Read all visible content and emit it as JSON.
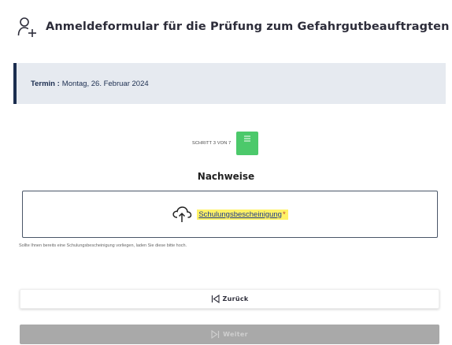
{
  "header": {
    "title": "Anmeldeformular für die Prüfung zum Gefahrgutbeauftragten",
    "icon": "person-add-icon"
  },
  "termin": {
    "label": "Termin :",
    "value": "Montag, 26. Februar 2024"
  },
  "step": {
    "text": "SCHRITT 3 VON 7",
    "icon": "list-icon",
    "color": "#4cc96b"
  },
  "section": {
    "title": "Nachweise"
  },
  "upload": {
    "icon": "cloud-upload-icon",
    "link_text": "Schulungsbescheinigung",
    "required_mark": "*"
  },
  "hint": "Sollte Ihnen bereits eine Schulungsbescheinigung vorliegen, laden Sie diese bitte hoch.",
  "buttons": {
    "back": {
      "label": "Zurück",
      "icon": "skip-back-icon"
    },
    "next": {
      "label": "Weiter",
      "icon": "skip-forward-icon",
      "disabled": true
    }
  },
  "colors": {
    "termin_bg": "#e6eaf0",
    "termin_border": "#1b2d4f",
    "highlight": "#fff266",
    "next_bg": "#a9a9a9"
  }
}
